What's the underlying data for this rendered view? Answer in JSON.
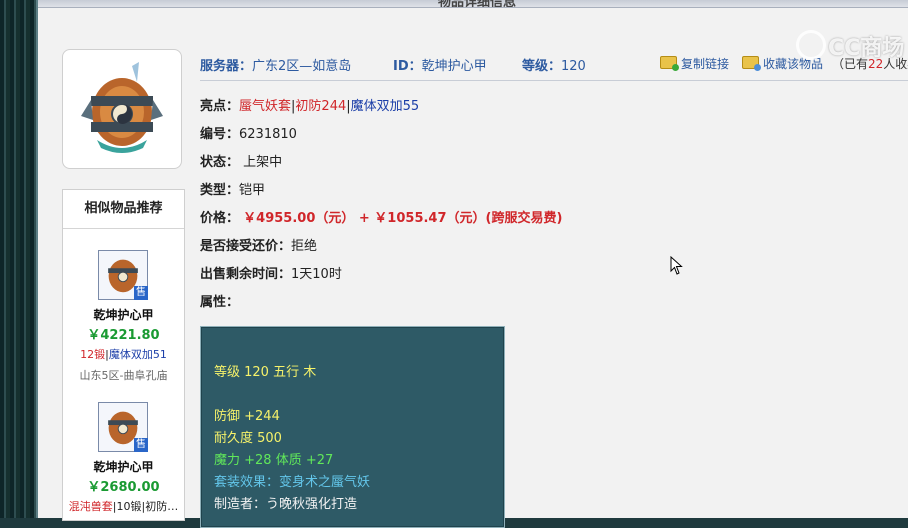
{
  "header": {
    "title": "物品详细信息"
  },
  "info": {
    "server_label": "服务器：",
    "server_value": "广东2区—如意岛",
    "id_label": "ID：",
    "id_value": "乾坤护心甲",
    "level_label": "等级：",
    "level_value": "120",
    "copy_link": "复制链接",
    "favorite": "收藏该物品",
    "fav_count_prefix": "（已有",
    "fav_count": "22",
    "fav_count_suffix": "人收藏"
  },
  "details": {
    "highlight_label": "亮点：",
    "highlight_1": "蜃气妖套",
    "highlight_sep": "|",
    "highlight_2": "初防244",
    "highlight_3": "魔体双加55",
    "number_label": "编号：",
    "number_value": "6231810",
    "status_label": "状态：",
    "status_value": "上架中",
    "type_label": "类型：",
    "type_value": "铠甲",
    "price_label": "价格：",
    "price_value": "￥4955.00（元） + ￥1055.47（元）(跨服交易费)",
    "counter_label": "是否接受还价：",
    "counter_value": "拒绝",
    "time_label": "出售剩余时间：",
    "time_value": "1天10时",
    "attr_label": "属性："
  },
  "attributes": {
    "level_line": "等级 120 五行 木",
    "defense": "防御 +244",
    "durability": "耐久度 500",
    "stats": "魔力 +28 体质 +27",
    "set_effect": "套装效果：变身术之蜃气妖",
    "maker": "制造者：う晚秋强化打造"
  },
  "similar": {
    "title": "相似物品推荐",
    "sale_badge": "售",
    "items": [
      {
        "name": "乾坤护心甲",
        "price": "￥4221.80",
        "tag_red": "12锻",
        "tag_sep": "|",
        "tag_blue": "魔体双加51",
        "server": "山东5区-曲阜孔庙"
      },
      {
        "name": "乾坤护心甲",
        "price": "￥2680.00",
        "tag_red": "混沌兽套",
        "tag_sep": "|",
        "tag_blue": "10锻|初防…",
        "server": ""
      }
    ]
  },
  "watermark": "CC商场",
  "colors": {
    "link_blue": "#2d5aa0",
    "price_red": "#d0262a",
    "price_green": "#1a9a32",
    "attr_bg": "#2e5a66"
  }
}
